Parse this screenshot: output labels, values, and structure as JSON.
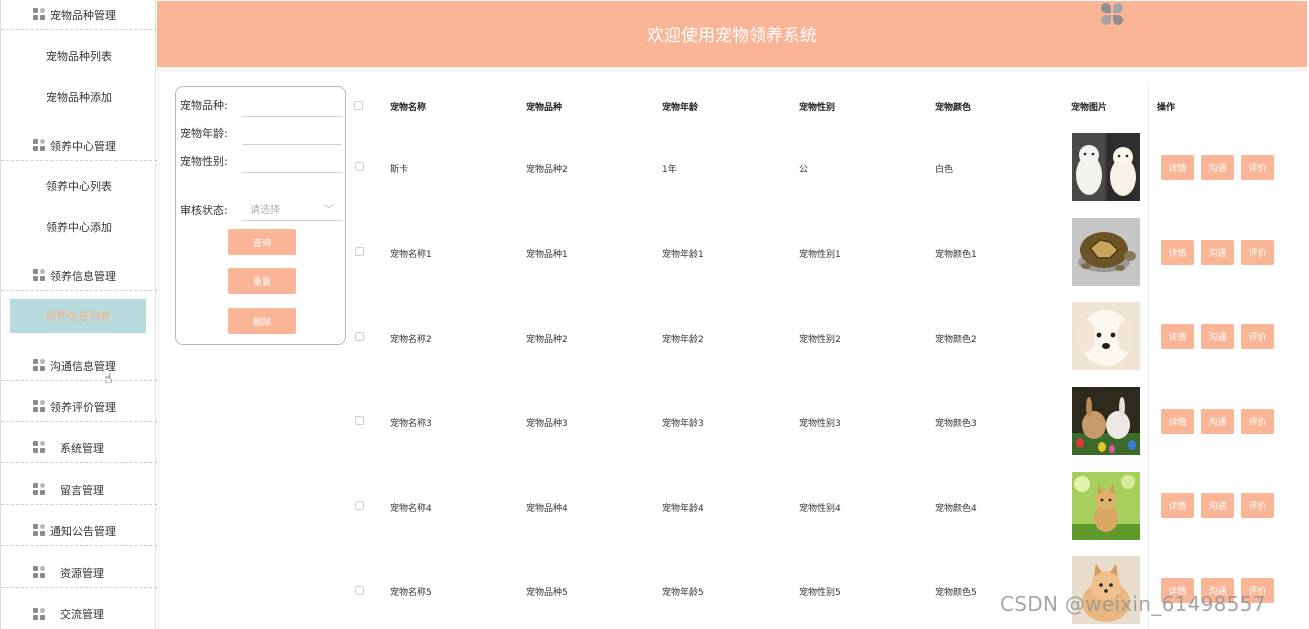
{
  "header": {
    "title": "欢迎使用宠物领养系统"
  },
  "sidebar": {
    "groups": [
      {
        "label": "宠物品种管理"
      },
      {
        "label": "领养中心管理"
      },
      {
        "label": "领养信息管理"
      },
      {
        "label": "沟通信息管理"
      },
      {
        "label": "领养评价管理"
      },
      {
        "label": "系统管理"
      },
      {
        "label": "留言管理"
      },
      {
        "label": "通知公告管理"
      },
      {
        "label": "资源管理"
      },
      {
        "label": "交流管理"
      }
    ],
    "items": [
      {
        "label": "宠物品种列表"
      },
      {
        "label": "宠物品种添加"
      },
      {
        "label": "领养中心列表"
      },
      {
        "label": "领养中心添加"
      },
      {
        "label": "领养信息列表",
        "active": true
      }
    ]
  },
  "search": {
    "breed_label": "宠物品种:",
    "age_label": "宠物年龄:",
    "gender_label": "宠物性别:",
    "status_label": "审核状态:",
    "status_placeholder": "请选择",
    "query_button": "查询",
    "reset_button": "重置",
    "delete_button": "删除"
  },
  "table": {
    "headers": [
      "宠物名称",
      "宠物品种",
      "宠物年龄",
      "宠物性别",
      "宠物颜色",
      "宠物图片",
      "操作"
    ],
    "rows": [
      {
        "name": "斯卡",
        "breed": "宠物品种2",
        "age": "1年",
        "gender": "公",
        "color": "白色",
        "image": "two-white-pomeranians"
      },
      {
        "name": "宠物名称1",
        "breed": "宠物品种1",
        "age": "宠物年龄1",
        "gender": "宠物性别1",
        "color": "宠物颜色1",
        "image": "tortoise"
      },
      {
        "name": "宠物名称2",
        "breed": "宠物品种2",
        "age": "宠物年龄2",
        "gender": "宠物性别2",
        "color": "宠物颜色2",
        "image": "white-puppy"
      },
      {
        "name": "宠物名称3",
        "breed": "宠物品种3",
        "age": "宠物年龄3",
        "gender": "宠物性别3",
        "color": "宠物颜色3",
        "image": "rabbits-easter-eggs"
      },
      {
        "name": "宠物名称4",
        "breed": "宠物品种4",
        "age": "宠物年龄4",
        "gender": "宠物性别4",
        "color": "宠物颜色4",
        "image": "kitten-grass"
      },
      {
        "name": "宠物名称5",
        "breed": "宠物品种5",
        "age": "宠物年龄5",
        "gender": "宠物性别5",
        "color": "宠物颜色5",
        "image": "pomeranian"
      }
    ],
    "actions": {
      "detail": "详情",
      "chat": "沟通",
      "review": "评价"
    }
  },
  "watermark": "CSDN @weixin_61498557",
  "colors": {
    "accent": "#f9b595",
    "active_bg": "#b8dcdd"
  }
}
